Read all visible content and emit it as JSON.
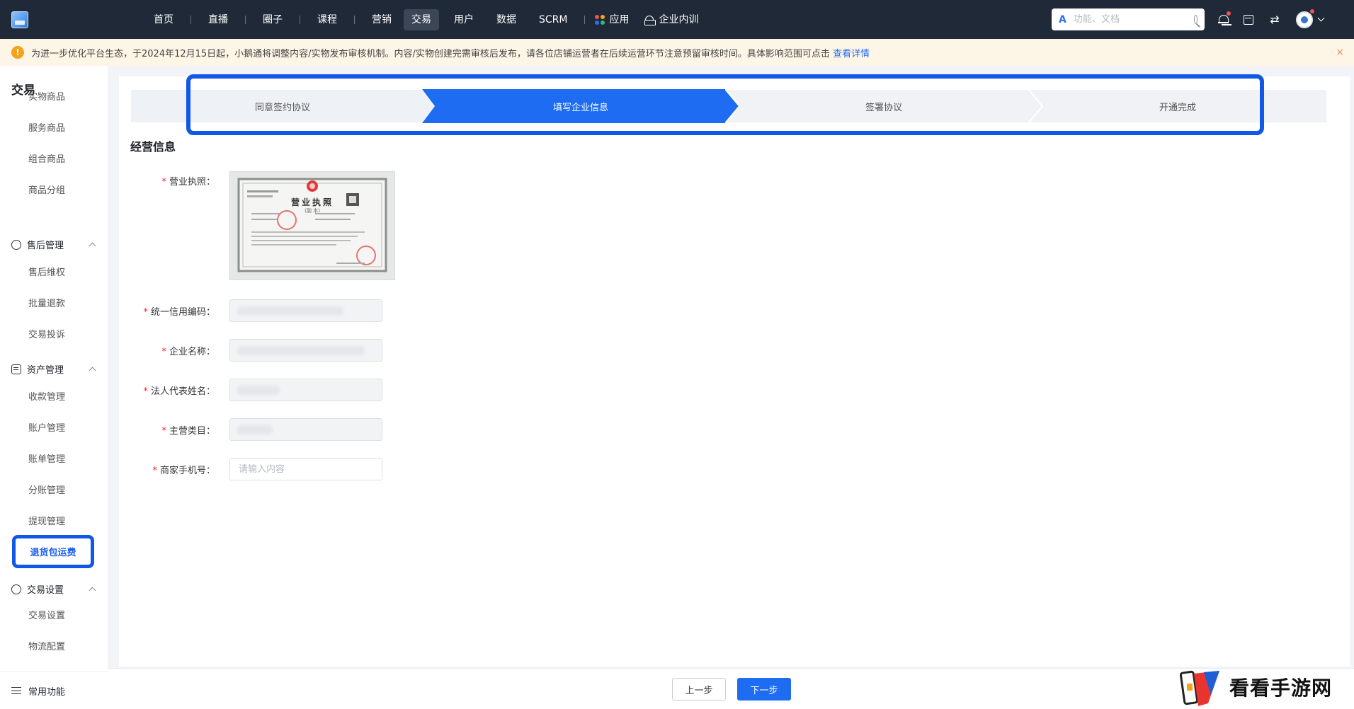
{
  "topnav": {
    "items": [
      {
        "label": "首页"
      },
      {
        "label": "直播"
      },
      {
        "label": "圈子"
      },
      {
        "label": "课程"
      },
      {
        "label": "营销"
      },
      {
        "label": "交易",
        "active": true
      },
      {
        "label": "用户"
      },
      {
        "label": "数据"
      },
      {
        "label": "SCRM"
      }
    ],
    "apps_label": "应用",
    "training_label": "企业内训",
    "search_placeholder": "功能、文档",
    "icons": [
      "bell-icon",
      "store-icon",
      "switch-icon",
      "avatar",
      "chevron-down-icon"
    ]
  },
  "notice": {
    "text": "为进一步优化平台生态，于2024年12月15日起，小鹅通将调整内容/实物发布审核机制。内容/实物创建完需审核后发布，请各位店铺运营者在后续运营环节注意预留审核时间。具体影响范围可点击",
    "link_text": "查看详情",
    "close": "×"
  },
  "sidebar": {
    "title": "交易",
    "items_top": [
      "实物商品",
      "服务商品",
      "组合商品",
      "商品分组"
    ],
    "groups": [
      {
        "label": "售后管理",
        "items": [
          "售后维权",
          "批量退款",
          "交易投诉"
        ]
      },
      {
        "label": "资产管理",
        "items": [
          "收款管理",
          "账户管理",
          "账单管理",
          "分账管理",
          "提现管理",
          "退货包运费"
        ]
      },
      {
        "label": "交易设置",
        "items": [
          "交易设置",
          "物流配置"
        ]
      }
    ],
    "highlighted": "退货包运费",
    "footer": "常用功能"
  },
  "steps": [
    {
      "label": "同意签约协议",
      "state": "done"
    },
    {
      "label": "填写企业信息",
      "state": "active"
    },
    {
      "label": "签署协议",
      "state": "pending"
    },
    {
      "label": "开通完成",
      "state": "pending"
    }
  ],
  "section_title": "经营信息",
  "form": {
    "fields": [
      {
        "label": "营业执照：",
        "required": true,
        "type": "image"
      },
      {
        "label": "统一信用编码：",
        "required": true,
        "type": "disabled"
      },
      {
        "label": "企业名称：",
        "required": true,
        "type": "disabled"
      },
      {
        "label": "法人代表姓名：",
        "required": true,
        "type": "disabled"
      },
      {
        "label": "主营类目：",
        "required": true,
        "type": "disabled"
      },
      {
        "label": "商家手机号：",
        "required": true,
        "type": "input",
        "value": "",
        "placeholder": "请输入内容"
      }
    ],
    "license_image": {
      "title": "营业执照",
      "subtitle": "(副 本)"
    }
  },
  "actions": {
    "prev": "上一步",
    "next": "下一步"
  },
  "watermark": {
    "text": "看看手游网"
  },
  "colors": {
    "accent": "#1d6cf2",
    "highlight_frame": "#1258e6",
    "topbar": "#1f2937",
    "notice_bg": "#fdf5e6",
    "required": "#f5222d"
  }
}
